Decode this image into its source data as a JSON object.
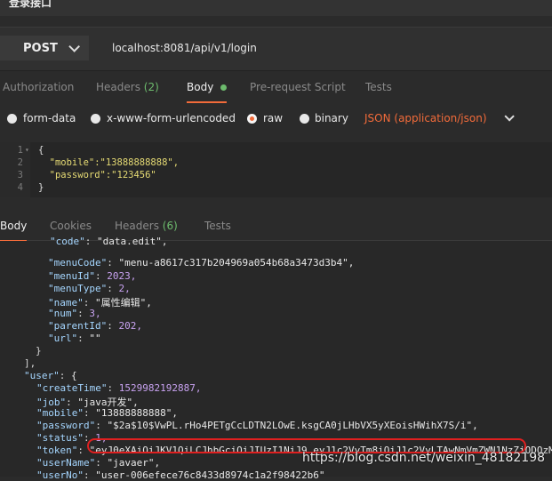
{
  "window": {
    "title": "登录接口"
  },
  "request": {
    "method": "POST",
    "url": "localhost:8081/api/v1/login"
  },
  "request_tabs": {
    "authorization": "Authorization",
    "headers": "Headers",
    "headers_count": "(2)",
    "body": "Body",
    "prerequest": "Pre-request Script",
    "tests": "Tests"
  },
  "body_types": {
    "form_data": "form-data",
    "urlencoded": "x-www-form-urlencoded",
    "raw": "raw",
    "binary": "binary",
    "content_type": "JSON (application/json)",
    "selected": "raw"
  },
  "editor": {
    "line_numbers": [
      "1",
      "2",
      "3",
      "4"
    ],
    "lines": [
      "{",
      "  \"mobile\":\"13888888888\",",
      "  \"password\":\"123456\"",
      "}"
    ]
  },
  "response_tabs": {
    "body": "Body",
    "cookies": "Cookies",
    "headers": "Headers",
    "headers_count": "(6)",
    "tests": "Tests"
  },
  "response_lines": [
    "\"code\": \"data.edit\",",
    "\"menuCode\": \"menu-a8617c317b204969a054b68a3473d3b4\",",
    "\"menuId\": 2023,",
    "\"menuType\": 2,",
    "\"name\": \"属性编辑\",",
    "\"num\": 3,",
    "\"parentId\": 202,",
    "\"url\": \"\"",
    "}",
    "],",
    "\"user\": {",
    "\"createTime\": 1529982192887,",
    "\"job\": \"java开发\",",
    "\"mobile\": \"13888888888\",",
    "\"password\": \"$2a$10$VwPL.rHo4PETgCcLDTN2LOwE.ksgCA0jLHbVX5yXEoisHWihX7S/i\",",
    "\"status\": 1,",
    "\"token\": \"eyJ0eXAiOiJKV1QiLCJhbGciOiJIUzI1NiJ9.eyJ1c2VyTm8iOiJ1c2VyLTAwNmVmZWN1NzZiODQzM",
    "\"userName\": \"javaer\",",
    "\"userNo\": \"user-006efece76c8433d8974c1a2f98422b6\""
  ],
  "watermark": "https://blog.csdn.net/weixin_48182198",
  "colors": {
    "accent": "#f26b3a",
    "highlight": "#e02020",
    "status_green": "#6dbb6d"
  }
}
